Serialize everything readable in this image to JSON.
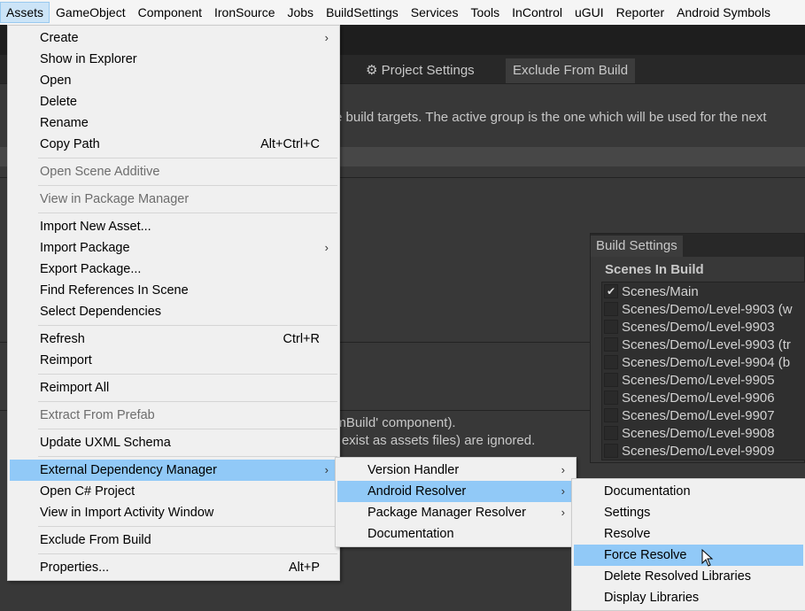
{
  "menubar": [
    "Assets",
    "GameObject",
    "Component",
    "IronSource",
    "Jobs",
    "BuildSettings",
    "Services",
    "Tools",
    "InControl",
    "uGUI",
    "Reporter",
    "Android Symbols"
  ],
  "background": {
    "tabs": [
      {
        "label": "Project Settings",
        "icon": "gear-icon"
      },
      {
        "label": "Exclude From Build"
      }
    ],
    "description": "e build targets. The active group is the one which will be used for the next",
    "notes": [
      "omBuild' component).",
      "st exist as assets files) are ignored."
    ]
  },
  "build_settings": {
    "tab": "Build Settings",
    "heading": "Scenes In Build",
    "scenes": [
      {
        "name": "Scenes/Main",
        "checked": true
      },
      {
        "name": "Scenes/Demo/Level-9903 (w",
        "checked": false
      },
      {
        "name": "Scenes/Demo/Level-9903",
        "checked": false
      },
      {
        "name": "Scenes/Demo/Level-9903 (tr",
        "checked": false
      },
      {
        "name": "Scenes/Demo/Level-9904 (b",
        "checked": false
      },
      {
        "name": "Scenes/Demo/Level-9905",
        "checked": false
      },
      {
        "name": "Scenes/Demo/Level-9906",
        "checked": false
      },
      {
        "name": "Scenes/Demo/Level-9907",
        "checked": false
      },
      {
        "name": "Scenes/Demo/Level-9908",
        "checked": false
      },
      {
        "name": "Scenes/Demo/Level-9909",
        "checked": false
      }
    ]
  },
  "assets_menu": [
    {
      "label": "Create",
      "submenu": true
    },
    {
      "label": "Show in Explorer"
    },
    {
      "label": "Open"
    },
    {
      "label": "Delete"
    },
    {
      "label": "Rename"
    },
    {
      "label": "Copy Path",
      "shortcut": "Alt+Ctrl+C"
    },
    {
      "sep": true
    },
    {
      "label": "Open Scene Additive",
      "disabled": true
    },
    {
      "sep": true
    },
    {
      "label": "View in Package Manager",
      "disabled": true
    },
    {
      "sep": true
    },
    {
      "label": "Import New Asset..."
    },
    {
      "label": "Import Package",
      "submenu": true
    },
    {
      "label": "Export Package..."
    },
    {
      "label": "Find References In Scene"
    },
    {
      "label": "Select Dependencies"
    },
    {
      "sep": true
    },
    {
      "label": "Refresh",
      "shortcut": "Ctrl+R"
    },
    {
      "label": "Reimport"
    },
    {
      "sep": true
    },
    {
      "label": "Reimport All"
    },
    {
      "sep": true
    },
    {
      "label": "Extract From Prefab",
      "disabled": true
    },
    {
      "sep": true
    },
    {
      "label": "Update UXML Schema"
    },
    {
      "sep": true
    },
    {
      "label": "External Dependency Manager",
      "submenu": true,
      "highlighted": true
    },
    {
      "label": "Open C# Project"
    },
    {
      "label": "View in Import Activity Window"
    },
    {
      "sep": true
    },
    {
      "label": "Exclude From Build"
    },
    {
      "sep": true
    },
    {
      "label": "Properties...",
      "shortcut": "Alt+P"
    }
  ],
  "edm_menu": [
    {
      "label": "Version Handler",
      "submenu": true
    },
    {
      "label": "Android Resolver",
      "submenu": true,
      "highlighted": true
    },
    {
      "label": "Package Manager Resolver",
      "submenu": true
    },
    {
      "label": "Documentation"
    }
  ],
  "android_resolver_menu": [
    {
      "label": "Documentation"
    },
    {
      "label": "Settings"
    },
    {
      "label": "Resolve"
    },
    {
      "label": "Force Resolve",
      "highlighted": true
    },
    {
      "label": "Delete Resolved Libraries"
    },
    {
      "label": "Display Libraries"
    }
  ]
}
